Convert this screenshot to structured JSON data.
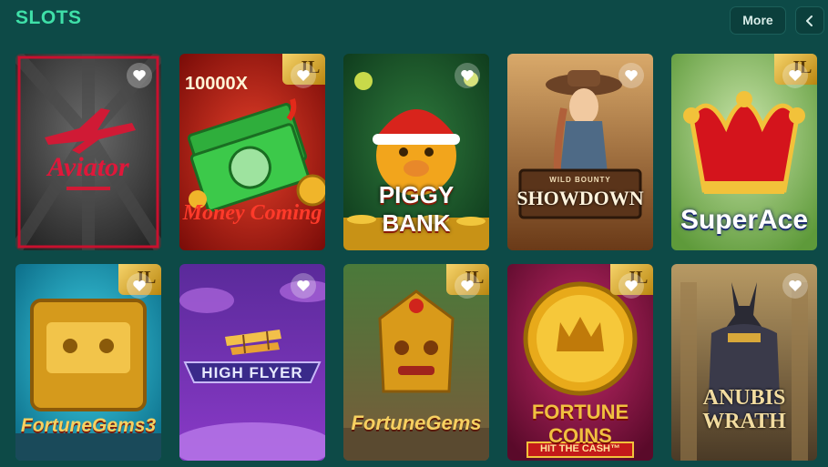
{
  "section": {
    "title": "SLOTS",
    "more_label": "More"
  },
  "icons": {
    "prev": "chevron-left-icon",
    "favorite": "heart-icon",
    "badge": "jili-badge-icon"
  },
  "games": [
    {
      "title": "Aviator",
      "subtitle": "",
      "top_text": "",
      "has_badge": false
    },
    {
      "title": "Money Coming",
      "subtitle": "",
      "top_text": "10000X",
      "has_badge": true
    },
    {
      "title": "PIGGY BANK",
      "subtitle": "",
      "top_text": "",
      "has_badge": false
    },
    {
      "title": "SHOWDOWN",
      "subtitle": "WILD BOUNTY",
      "top_text": "",
      "has_badge": false
    },
    {
      "title": "SuperAce",
      "subtitle": "",
      "top_text": "",
      "has_badge": true
    },
    {
      "title": "FortuneGems3",
      "subtitle": "",
      "top_text": "",
      "has_badge": true
    },
    {
      "title": "HIGH FLYER",
      "subtitle": "",
      "top_text": "",
      "has_badge": false
    },
    {
      "title": "FortuneGems",
      "subtitle": "",
      "top_text": "",
      "has_badge": true
    },
    {
      "title": "FORTUNE COINS",
      "subtitle": "HIT THE CASH™",
      "top_text": "",
      "has_badge": true
    },
    {
      "title": "ANUBIS WRATH",
      "subtitle": "",
      "top_text": "",
      "has_badge": false
    }
  ]
}
